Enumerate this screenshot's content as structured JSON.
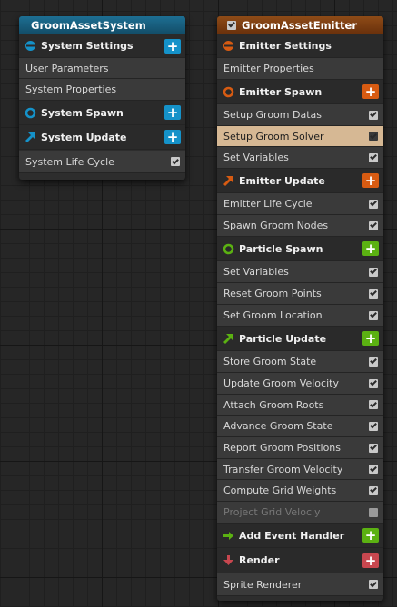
{
  "system": {
    "title": "GroomAssetSystem",
    "header_color": "#1a5c7a",
    "settings": "System Settings",
    "user_params": "User Parameters",
    "sys_props": "System Properties",
    "spawn": "System Spawn",
    "update": "System Update",
    "life_cycle": "System Life Cycle",
    "life_cycle_enabled": true
  },
  "emitter": {
    "title": "GroomAssetEmitter",
    "title_enabled": true,
    "header_color": "#7a3d12",
    "settings": "Emitter Settings",
    "props": "Emitter Properties",
    "spawn": {
      "label": "Emitter Spawn",
      "modules": [
        {
          "label": "Setup Groom Datas",
          "enabled": true
        },
        {
          "label": "Setup Groom Solver",
          "enabled": true,
          "selected": true
        },
        {
          "label": "Set Variables",
          "enabled": true
        }
      ]
    },
    "update": {
      "label": "Emitter Update",
      "modules": [
        {
          "label": "Emitter Life Cycle",
          "enabled": true
        },
        {
          "label": "Spawn Groom Nodes",
          "enabled": true
        }
      ]
    },
    "particle_spawn": {
      "label": "Particle Spawn",
      "modules": [
        {
          "label": "Set Variables",
          "enabled": true
        },
        {
          "label": "Reset Groom Points",
          "enabled": true
        },
        {
          "label": "Set Groom Location",
          "enabled": true
        }
      ]
    },
    "particle_update": {
      "label": "Particle Update",
      "modules": [
        {
          "label": "Store Groom State",
          "enabled": true
        },
        {
          "label": "Update Groom Velocity",
          "enabled": true
        },
        {
          "label": "Attach Groom Roots",
          "enabled": true
        },
        {
          "label": "Advance Groom State",
          "enabled": true
        },
        {
          "label": "Report Groom Positions",
          "enabled": true
        },
        {
          "label": "Transfer Groom Velocity",
          "enabled": true
        },
        {
          "label": "Compute Grid Weights",
          "enabled": true
        },
        {
          "label": "Project Grid Velociy",
          "enabled": false
        }
      ]
    },
    "event": "Add Event Handler",
    "render": {
      "label": "Render",
      "modules": [
        {
          "label": "Sprite Renderer",
          "enabled": true
        }
      ]
    }
  },
  "colors": {
    "blue": "#1592c9",
    "orange": "#d75b12",
    "green": "#5bb112",
    "red": "#c8474f",
    "selected": "#d6b894"
  }
}
